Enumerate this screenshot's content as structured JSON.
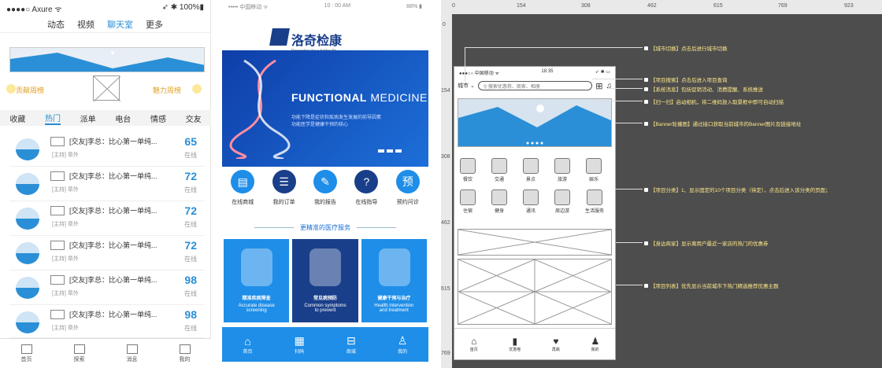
{
  "phone1": {
    "status_left": "●●●●○ Axure ᯤ",
    "status_right": "➶ ✱ 100%▮",
    "tabs": [
      {
        "label": "动态",
        "active": false
      },
      {
        "label": "视频",
        "active": false
      },
      {
        "label": "聊天室",
        "active": true
      },
      {
        "label": "更多",
        "active": false
      }
    ],
    "left_link": "贡献周榜",
    "right_link": "魅力周榜",
    "categories": [
      {
        "label": "收藏",
        "active": false
      },
      {
        "label": "热门",
        "active": true
      },
      {
        "label": "派单",
        "active": false
      },
      {
        "label": "电台",
        "active": false
      },
      {
        "label": "情感",
        "active": false
      },
      {
        "label": "交友",
        "active": false
      }
    ],
    "items": [
      {
        "title": "[交友]李总：比心第一单纯...",
        "sub": "[主持] 章外",
        "count": "65",
        "status": "在线"
      },
      {
        "title": "[交友]李总：比心第一单纯...",
        "sub": "[主持] 章外",
        "count": "72",
        "status": "在线"
      },
      {
        "title": "[交友]李总：比心第一单纯...",
        "sub": "[主持] 章外",
        "count": "72",
        "status": "在线"
      },
      {
        "title": "[交友]李总：比心第一单纯...",
        "sub": "[主持] 章外",
        "count": "72",
        "status": "在线"
      },
      {
        "title": "[交友]李总：比心第一单纯...",
        "sub": "[主持] 章外",
        "count": "98",
        "status": "在线"
      },
      {
        "title": "[交友]李总：比心第一单纯...",
        "sub": "[主持] 章外",
        "count": "98",
        "status": "在线"
      }
    ],
    "bottom_nav": [
      "首页",
      "探索",
      "消息",
      "我的"
    ]
  },
  "phone2": {
    "status_left": "••••• 中国移动 ᯤ",
    "status_center": "10 : 00 AM",
    "status_right": "88% ▮",
    "brand_name": "洛奇检康",
    "brand_tagline": "Prevention for a better life",
    "hero_title_bold": "FUNCTIONAL",
    "hero_title_light": " MEDICINE",
    "hero_desc_1": "功能下降是症状和疾病发生发展的前导因素",
    "hero_desc_2": "功能医学是健康干预的核心",
    "quick_icons": [
      {
        "label": "在线商城",
        "glyph": "▤",
        "dark": false
      },
      {
        "label": "我的订单",
        "glyph": "☰",
        "dark": true
      },
      {
        "label": "我的报告",
        "glyph": "✎",
        "dark": false
      },
      {
        "label": "在线指导",
        "glyph": "?",
        "dark": true
      },
      {
        "label": "预约问诊",
        "glyph": "预",
        "dark": false
      }
    ],
    "section_title": "更精准的医疗服务",
    "cards": [
      {
        "title": "精准疾病筛查",
        "desc_1": "Accurate disease",
        "desc_2": "screening",
        "mid": false
      },
      {
        "title": "常见病预防",
        "desc_1": "Common symptoms",
        "desc_2": "to prevent",
        "mid": true
      },
      {
        "title": "健康干预与治疗",
        "desc_1": "Health intervention",
        "desc_2": "and treatment",
        "mid": false
      }
    ],
    "tabbar": [
      {
        "label": "首页",
        "glyph": "⌂"
      },
      {
        "label": "扫码",
        "glyph": "▦"
      },
      {
        "label": "商城",
        "glyph": "⊟"
      },
      {
        "label": "我的",
        "glyph": "♙"
      }
    ]
  },
  "panel3": {
    "ruler_top": [
      "0",
      "154",
      "308",
      "462",
      "615",
      "769",
      "923"
    ],
    "ruler_left": [
      "0",
      "154",
      "308",
      "462",
      "615",
      "769"
    ],
    "screen": {
      "status_left": "●●●○○ 中国移动 ᯤ",
      "status_center": "18:35",
      "status_right": "➶ ✱ ▭",
      "city": "城市",
      "search_placeholder": "搜索优惠券、商家、相册",
      "grid": [
        "餐饮",
        "交通",
        "景点",
        "旅游",
        "娱乐",
        "住宿",
        "健身",
        "通讯",
        "周边游",
        "生活服务"
      ],
      "nav": [
        "首页",
        "优惠卷",
        "再跳",
        "我的"
      ]
    },
    "annotations": [
      "【城市切换】点击后进行城市切换",
      "【项目搜索】点击后进入项目查询",
      "【系统消息】包括促销活动、消费提醒、系统推送",
      "【扫一扫】启动相机，将二维码放入取景框中即可自动扫描",
      "【Banner轮播图】通过接口获取当前城市的Banner图片及链接地址",
      "【项目分类】1、显示固定的10个项目分类（待定），点击后进入该分类的页面；",
      "【身边商家】显示离用户最近一家店的热门的优惠券",
      "【项目列表】优先显示当前城市下热门精选推荐优惠主题"
    ]
  }
}
